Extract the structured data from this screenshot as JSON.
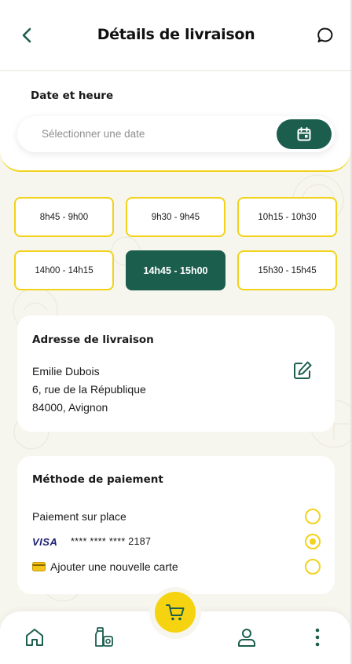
{
  "header": {
    "title": "Détails de livraison",
    "back_icon": "chevron-left-icon",
    "chat_icon": "chat-bubble-icon"
  },
  "date_section": {
    "label": "Date et heure",
    "placeholder": "Sélectionner une date",
    "calendar_icon": "calendar-icon"
  },
  "time_slots": [
    {
      "label": "8h45 - 9h00",
      "selected": false
    },
    {
      "label": "9h30 - 9h45",
      "selected": false
    },
    {
      "label": "10h15 - 10h30",
      "selected": false
    },
    {
      "label": "14h00 - 14h15",
      "selected": false
    },
    {
      "label": "14h45 - 15h00",
      "selected": true
    },
    {
      "label": "15h30 - 15h45",
      "selected": false
    }
  ],
  "address": {
    "title": "Adresse de livraison",
    "name": "Emilie Dubois",
    "street": "6, rue de la République",
    "city": "84000, Avignon",
    "edit_icon": "edit-icon"
  },
  "payment": {
    "title": "Méthode de paiement",
    "options": [
      {
        "label": "Paiement sur place",
        "selected": false
      },
      {
        "brand": "VISA",
        "label": "**** **** **** 2187",
        "selected": true
      },
      {
        "label": "Ajouter une nouvelle carte",
        "selected": false
      }
    ]
  },
  "bottom_nav": {
    "items": [
      "home-icon",
      "groceries-icon",
      "cart-icon",
      "profile-icon",
      "more-vertical-icon"
    ]
  },
  "colors": {
    "primary_green": "#1c5e4e",
    "accent_yellow": "#f2d21b",
    "background": "#f7f6ee"
  }
}
